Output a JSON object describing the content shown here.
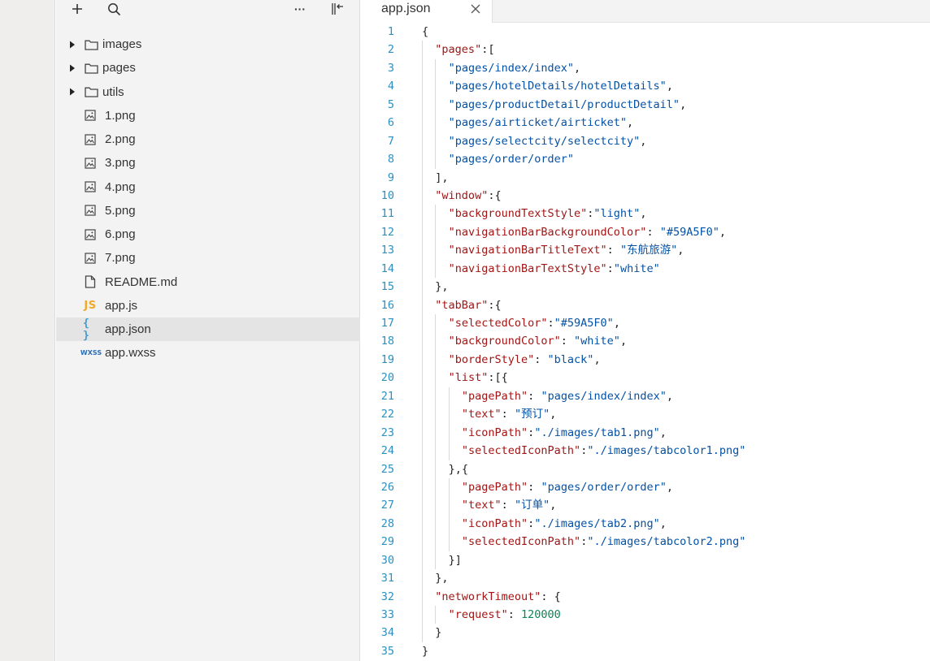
{
  "toolbar": {
    "add_icon": "plus-icon",
    "search_icon": "search-icon",
    "more_label": "···",
    "collapse_icon": "collapse-panel-icon"
  },
  "tree": {
    "items": [
      {
        "label": "images",
        "kind": "folder"
      },
      {
        "label": "pages",
        "kind": "folder"
      },
      {
        "label": "utils",
        "kind": "folder"
      },
      {
        "label": "1.png",
        "kind": "image"
      },
      {
        "label": "2.png",
        "kind": "image"
      },
      {
        "label": "3.png",
        "kind": "image"
      },
      {
        "label": "4.png",
        "kind": "image"
      },
      {
        "label": "5.png",
        "kind": "image"
      },
      {
        "label": "6.png",
        "kind": "image"
      },
      {
        "label": "7.png",
        "kind": "image"
      },
      {
        "label": "README.md",
        "kind": "doc"
      },
      {
        "label": "app.js",
        "kind": "js",
        "badge": "JS"
      },
      {
        "label": "app.json",
        "kind": "json",
        "badge": "{ }",
        "selected": true
      },
      {
        "label": "app.wxss",
        "kind": "wxss",
        "badge": "WXSS"
      }
    ]
  },
  "editor": {
    "tab_title": "app.json",
    "tab_close": "×",
    "lines": [
      {
        "n": "1",
        "indent": 0,
        "tokens": [
          {
            "t": "{",
            "c": "p"
          }
        ]
      },
      {
        "n": "2",
        "indent": 1,
        "tokens": [
          {
            "t": "\"pages\"",
            "c": "k"
          },
          {
            "t": ":[",
            "c": "p"
          }
        ]
      },
      {
        "n": "3",
        "indent": 2,
        "tokens": [
          {
            "t": "\"pages/index/index\"",
            "c": "s"
          },
          {
            "t": ",",
            "c": "p"
          }
        ]
      },
      {
        "n": "4",
        "indent": 2,
        "tokens": [
          {
            "t": "\"pages/hotelDetails/hotelDetails\"",
            "c": "s"
          },
          {
            "t": ",",
            "c": "p"
          }
        ]
      },
      {
        "n": "5",
        "indent": 2,
        "tokens": [
          {
            "t": "\"pages/productDetail/productDetail\"",
            "c": "s"
          },
          {
            "t": ",",
            "c": "p"
          }
        ]
      },
      {
        "n": "6",
        "indent": 2,
        "tokens": [
          {
            "t": "\"pages/airticket/airticket\"",
            "c": "s"
          },
          {
            "t": ",",
            "c": "p"
          }
        ]
      },
      {
        "n": "7",
        "indent": 2,
        "tokens": [
          {
            "t": "\"pages/selectcity/selectcity\"",
            "c": "s"
          },
          {
            "t": ",",
            "c": "p"
          }
        ]
      },
      {
        "n": "8",
        "indent": 2,
        "tokens": [
          {
            "t": "\"pages/order/order\"",
            "c": "s"
          }
        ]
      },
      {
        "n": "9",
        "indent": 1,
        "tokens": [
          {
            "t": "],",
            "c": "p"
          }
        ]
      },
      {
        "n": "10",
        "indent": 1,
        "tokens": [
          {
            "t": "\"window\"",
            "c": "k"
          },
          {
            "t": ":{",
            "c": "p"
          }
        ]
      },
      {
        "n": "11",
        "indent": 2,
        "tokens": [
          {
            "t": "\"backgroundTextStyle\"",
            "c": "k"
          },
          {
            "t": ":",
            "c": "p"
          },
          {
            "t": "\"light\"",
            "c": "s"
          },
          {
            "t": ",",
            "c": "p"
          }
        ]
      },
      {
        "n": "12",
        "indent": 2,
        "tokens": [
          {
            "t": "\"navigationBarBackgroundColor\"",
            "c": "k"
          },
          {
            "t": ": ",
            "c": "p"
          },
          {
            "t": "\"#59A5F0\"",
            "c": "s"
          },
          {
            "t": ",",
            "c": "p"
          }
        ]
      },
      {
        "n": "13",
        "indent": 2,
        "tokens": [
          {
            "t": "\"navigationBarTitleText\"",
            "c": "k"
          },
          {
            "t": ": ",
            "c": "p"
          },
          {
            "t": "\"东航旅游\"",
            "c": "s"
          },
          {
            "t": ",",
            "c": "p"
          }
        ]
      },
      {
        "n": "14",
        "indent": 2,
        "tokens": [
          {
            "t": "\"navigationBarTextStyle\"",
            "c": "k"
          },
          {
            "t": ":",
            "c": "p"
          },
          {
            "t": "\"white\"",
            "c": "s"
          }
        ]
      },
      {
        "n": "15",
        "indent": 1,
        "tokens": [
          {
            "t": "},",
            "c": "p"
          }
        ]
      },
      {
        "n": "16",
        "indent": 1,
        "tokens": [
          {
            "t": "\"tabBar\"",
            "c": "k"
          },
          {
            "t": ":{",
            "c": "p"
          }
        ]
      },
      {
        "n": "17",
        "indent": 2,
        "tokens": [
          {
            "t": "\"selectedColor\"",
            "c": "k"
          },
          {
            "t": ":",
            "c": "p"
          },
          {
            "t": "\"#59A5F0\"",
            "c": "s"
          },
          {
            "t": ",",
            "c": "p"
          }
        ]
      },
      {
        "n": "18",
        "indent": 2,
        "tokens": [
          {
            "t": "\"backgroundColor\"",
            "c": "k"
          },
          {
            "t": ": ",
            "c": "p"
          },
          {
            "t": "\"white\"",
            "c": "s"
          },
          {
            "t": ",",
            "c": "p"
          }
        ]
      },
      {
        "n": "19",
        "indent": 2,
        "tokens": [
          {
            "t": "\"borderStyle\"",
            "c": "k"
          },
          {
            "t": ": ",
            "c": "p"
          },
          {
            "t": "\"black\"",
            "c": "s"
          },
          {
            "t": ",",
            "c": "p"
          }
        ]
      },
      {
        "n": "20",
        "indent": 2,
        "tokens": [
          {
            "t": "\"list\"",
            "c": "k"
          },
          {
            "t": ":[{",
            "c": "p"
          }
        ]
      },
      {
        "n": "21",
        "indent": 3,
        "tokens": [
          {
            "t": "\"pagePath\"",
            "c": "k"
          },
          {
            "t": ": ",
            "c": "p"
          },
          {
            "t": "\"pages/index/index\"",
            "c": "s"
          },
          {
            "t": ",",
            "c": "p"
          }
        ]
      },
      {
        "n": "22",
        "indent": 3,
        "tokens": [
          {
            "t": "\"text\"",
            "c": "k"
          },
          {
            "t": ": ",
            "c": "p"
          },
          {
            "t": "\"预订\"",
            "c": "s"
          },
          {
            "t": ",",
            "c": "p"
          }
        ]
      },
      {
        "n": "23",
        "indent": 3,
        "tokens": [
          {
            "t": "\"iconPath\"",
            "c": "k"
          },
          {
            "t": ":",
            "c": "p"
          },
          {
            "t": "\"./images/tab1.png\"",
            "c": "s"
          },
          {
            "t": ",",
            "c": "p"
          }
        ]
      },
      {
        "n": "24",
        "indent": 3,
        "tokens": [
          {
            "t": "\"selectedIconPath\"",
            "c": "k"
          },
          {
            "t": ":",
            "c": "p"
          },
          {
            "t": "\"./images/tabcolor1.png\"",
            "c": "s"
          }
        ]
      },
      {
        "n": "25",
        "indent": 2,
        "tokens": [
          {
            "t": "},{",
            "c": "p"
          }
        ]
      },
      {
        "n": "26",
        "indent": 3,
        "tokens": [
          {
            "t": "\"pagePath\"",
            "c": "k"
          },
          {
            "t": ": ",
            "c": "p"
          },
          {
            "t": "\"pages/order/order\"",
            "c": "s"
          },
          {
            "t": ",",
            "c": "p"
          }
        ]
      },
      {
        "n": "27",
        "indent": 3,
        "tokens": [
          {
            "t": "\"text\"",
            "c": "k"
          },
          {
            "t": ": ",
            "c": "p"
          },
          {
            "t": "\"订单\"",
            "c": "s"
          },
          {
            "t": ",",
            "c": "p"
          }
        ]
      },
      {
        "n": "28",
        "indent": 3,
        "tokens": [
          {
            "t": "\"iconPath\"",
            "c": "k"
          },
          {
            "t": ":",
            "c": "p"
          },
          {
            "t": "\"./images/tab2.png\"",
            "c": "s"
          },
          {
            "t": ",",
            "c": "p"
          }
        ]
      },
      {
        "n": "29",
        "indent": 3,
        "tokens": [
          {
            "t": "\"selectedIconPath\"",
            "c": "k"
          },
          {
            "t": ":",
            "c": "p"
          },
          {
            "t": "\"./images/tabcolor2.png\"",
            "c": "s"
          }
        ]
      },
      {
        "n": "30",
        "indent": 2,
        "tokens": [
          {
            "t": "}]",
            "c": "p"
          }
        ]
      },
      {
        "n": "31",
        "indent": 1,
        "tokens": [
          {
            "t": "},",
            "c": "p"
          }
        ]
      },
      {
        "n": "32",
        "indent": 1,
        "tokens": [
          {
            "t": "\"networkTimeout\"",
            "c": "k"
          },
          {
            "t": ": {",
            "c": "p"
          }
        ]
      },
      {
        "n": "33",
        "indent": 2,
        "tokens": [
          {
            "t": "\"request\"",
            "c": "k"
          },
          {
            "t": ": ",
            "c": "p"
          },
          {
            "t": "120000",
            "c": "n"
          }
        ]
      },
      {
        "n": "34",
        "indent": 1,
        "tokens": [
          {
            "t": "}",
            "c": "p"
          }
        ]
      },
      {
        "n": "35",
        "indent": 0,
        "tokens": [
          {
            "t": "}",
            "c": "p"
          }
        ]
      }
    ]
  },
  "colors": {
    "line_number": "#2b8fbf",
    "json_key": "#a31515",
    "json_string": "#0451a5",
    "json_number": "#098658",
    "selected_row": "#e4e4e4"
  }
}
